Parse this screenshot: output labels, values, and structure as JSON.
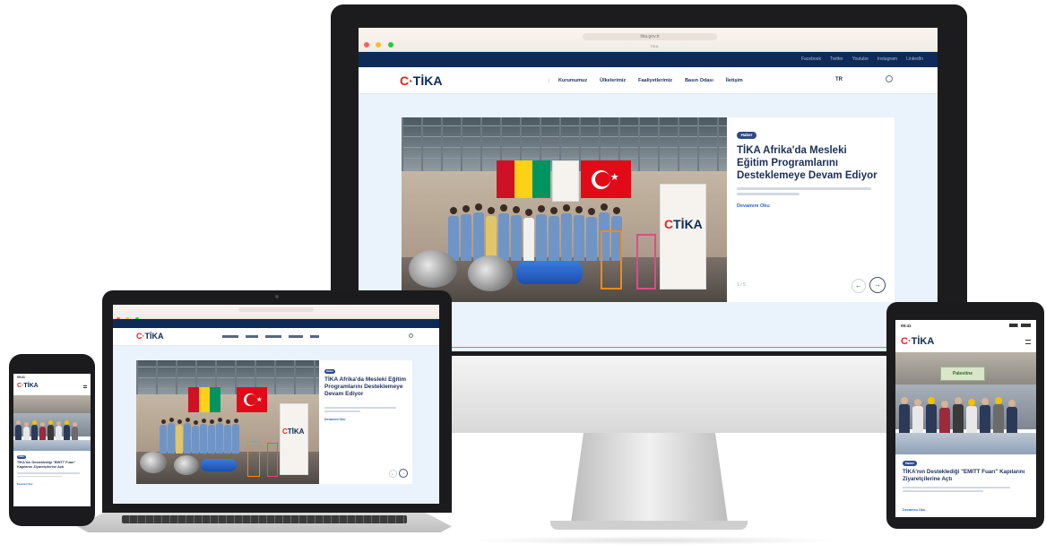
{
  "site": {
    "logo": "TİKA",
    "logo_mark": "C·"
  },
  "browser": {
    "url": "tika.gov.tr",
    "tab": "TİKA"
  },
  "desktop": {
    "topbar_links": [
      "Facebook",
      "Twitter",
      "Youtube",
      "Instagram",
      "LinkedIn"
    ],
    "nav": [
      "Kurumumuz",
      "Ülkelerimiz",
      "Faaliyetlerimiz",
      "Basın Odası",
      "İletişim"
    ],
    "lang": "TR",
    "slide": {
      "badge": "Haber",
      "title": "TİKA Afrika'da Mesleki Eğitim Programlarını Desteklemeye Devam Ediyor",
      "more": "Devamını Oku",
      "pager": "1 / 5"
    }
  },
  "laptop": {
    "slide": {
      "badge": "Haber",
      "title": "TİKA Afrika'da Mesleki Eğitim Programlarını Desteklemeye Devam Ediyor",
      "more": "Devamını Oku"
    }
  },
  "tablet": {
    "time": "09:41",
    "banner": "Palestine",
    "slide": {
      "badge": "Haber",
      "title": "TİKA'nın Desteklediği \"EMITT Fuarı\" Kapılarını Ziyaretçilerine Açtı",
      "more": "Devamını Oku"
    }
  },
  "phone": {
    "time": "09:41",
    "slide": {
      "badge": "Haber",
      "title": "TİKA'nın Desteklediği \"EMITT Fuarı\" Kapılarını Ziyaretçilerine Açtı",
      "more": "Devamını Oku"
    }
  },
  "colors": {
    "navy": "#0e2a57",
    "red": "#e1261c",
    "accent_blue": "#2b68c6",
    "screen_bg": "#eaf2fb"
  }
}
